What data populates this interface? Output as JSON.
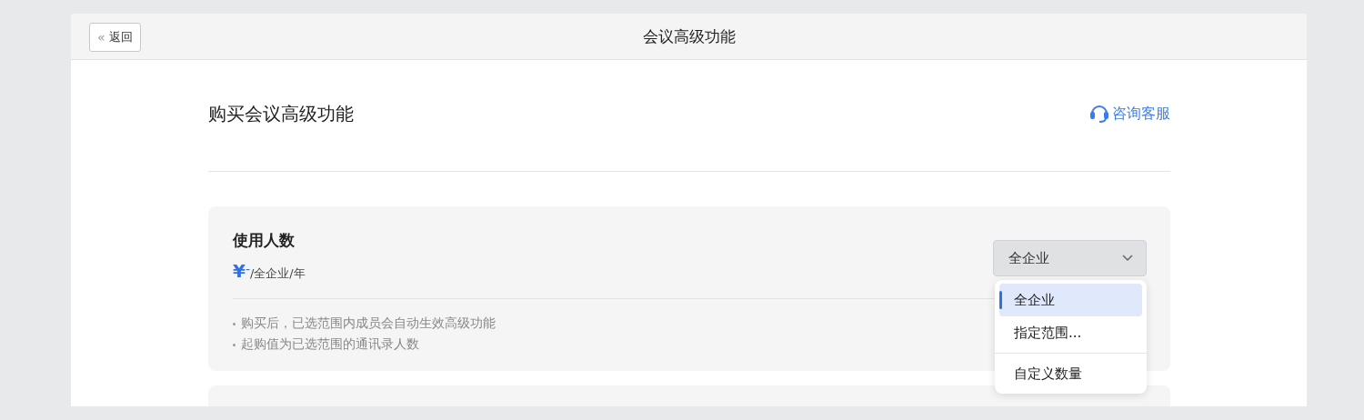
{
  "header": {
    "back_button": {
      "icon": "«",
      "label": "返回"
    },
    "title": "会议高级功能"
  },
  "page": {
    "title": "购买会议高级功能",
    "support_link": "咨询客服"
  },
  "seat_card": {
    "title": "使用人数",
    "price": {
      "currency": "¥",
      "amount": "-",
      "unit": "/全企业/年"
    },
    "notes": [
      "购买后，已选范围内成员会自动生效高级功能",
      "起购值为已选范围的通讯录人数"
    ],
    "select": {
      "value": "全企业",
      "expanded": true,
      "option_groups": [
        [
          {
            "label": "全企业",
            "selected": true
          },
          {
            "label": "指定范围...",
            "selected": false
          }
        ],
        [
          {
            "label": "自定义数量",
            "selected": false
          }
        ]
      ]
    }
  }
}
